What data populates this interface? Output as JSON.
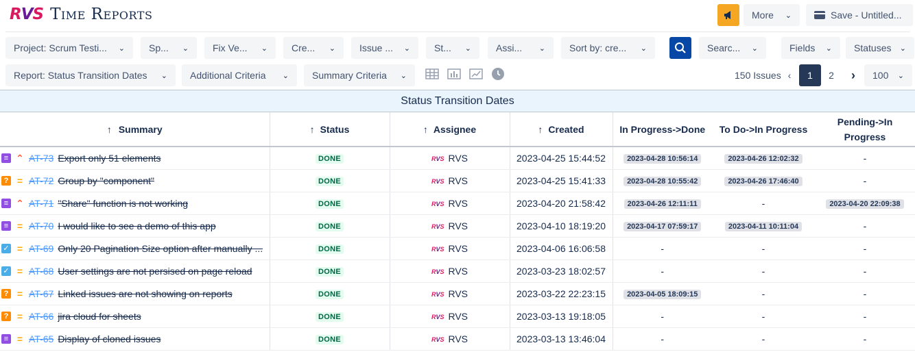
{
  "app": {
    "logo": "RVS",
    "title": "Time Reports"
  },
  "header": {
    "more_label": "More",
    "save_label": "Save - Untitled..."
  },
  "filters": {
    "project": "Project: Scrum Testi...",
    "sprint": "Sp...",
    "fix_version": "Fix Ve...",
    "created": "Cre...",
    "issue_type": "Issue ...",
    "status": "St...",
    "assignee": "Assi...",
    "sort": "Sort by: cre...",
    "search": "Searc...",
    "fields": "Fields",
    "statuses": "Statuses"
  },
  "report_bar": {
    "report": "Report: Status Transition Dates",
    "additional": "Additional Criteria",
    "summary_criteria": "Summary Criteria"
  },
  "pagination": {
    "count_label": "150 Issues",
    "pages": [
      "1",
      "2"
    ],
    "current": "1",
    "page_size": "100"
  },
  "report_title": "Status Transition Dates",
  "columns": {
    "summary": "Summary",
    "status": "Status",
    "assignee": "Assignee",
    "created": "Created",
    "t1": "In Progress->Done",
    "t2": "To Do->In Progress",
    "t3": "Pending->In Progress"
  },
  "sort_arrow": "↑",
  "rows": [
    {
      "type": "story",
      "priority": "high",
      "key": "AT-73",
      "summary": "Export only 51 elements",
      "status": "DONE",
      "assignee": "RVS",
      "created": "2023-04-25 15:44:52",
      "t1": "2023-04-28 10:56:14",
      "t2": "2023-04-26 12:02:32",
      "t3": "-"
    },
    {
      "type": "question",
      "priority": "medium",
      "key": "AT-72",
      "summary": "Group by \"component\"",
      "status": "DONE",
      "assignee": "RVS",
      "created": "2023-04-25 15:41:33",
      "t1": "2023-04-28 10:55:42",
      "t2": "2023-04-26 17:46:40",
      "t3": "-"
    },
    {
      "type": "story",
      "priority": "high",
      "key": "AT-71",
      "summary": "\"Share\" function is not working",
      "status": "DONE",
      "assignee": "RVS",
      "created": "2023-04-20 21:58:42",
      "t1": "2023-04-26 12:11:11",
      "t2": "-",
      "t3": "2023-04-20 22:09:38"
    },
    {
      "type": "story",
      "priority": "medium",
      "key": "AT-70",
      "summary": "I would like to see a demo of this app",
      "status": "DONE",
      "assignee": "RVS",
      "created": "2023-04-10 18:19:20",
      "t1": "2023-04-17 07:59:17",
      "t2": "2023-04-11 10:11:04",
      "t3": "-"
    },
    {
      "type": "task",
      "priority": "medium",
      "key": "AT-69",
      "summary": "Only 20 Pagination Size option after manually ...",
      "status": "DONE",
      "assignee": "RVS",
      "created": "2023-04-06 16:06:58",
      "t1": "-",
      "t2": "-",
      "t3": "-"
    },
    {
      "type": "task",
      "priority": "medium",
      "key": "AT-68",
      "summary": "User settings are not persised on page reload",
      "status": "DONE",
      "assignee": "RVS",
      "created": "2023-03-23 18:02:57",
      "t1": "-",
      "t2": "-",
      "t3": "-"
    },
    {
      "type": "question",
      "priority": "medium",
      "key": "AT-67",
      "summary": "Linked issues are not showing on reports",
      "status": "DONE",
      "assignee": "RVS",
      "created": "2023-03-22 22:23:15",
      "t1": "2023-04-05 18:09:15",
      "t2": "-",
      "t3": "-"
    },
    {
      "type": "question",
      "priority": "medium",
      "key": "AT-66",
      "summary": "jira cloud for sheets",
      "status": "DONE",
      "assignee": "RVS",
      "created": "2023-03-13 19:18:05",
      "t1": "-",
      "t2": "-",
      "t3": "-"
    },
    {
      "type": "story",
      "priority": "medium",
      "key": "AT-65",
      "summary": "Display of cloned issues",
      "status": "DONE",
      "assignee": "RVS",
      "created": "2023-03-13 13:46:04",
      "t1": "-",
      "t2": "-",
      "t3": "-"
    }
  ],
  "colors": {
    "accent": "#0747a6",
    "notify": "#f5a623",
    "brand": "#d81b60",
    "done_bg": "#e3fcef",
    "done_fg": "#006644"
  }
}
